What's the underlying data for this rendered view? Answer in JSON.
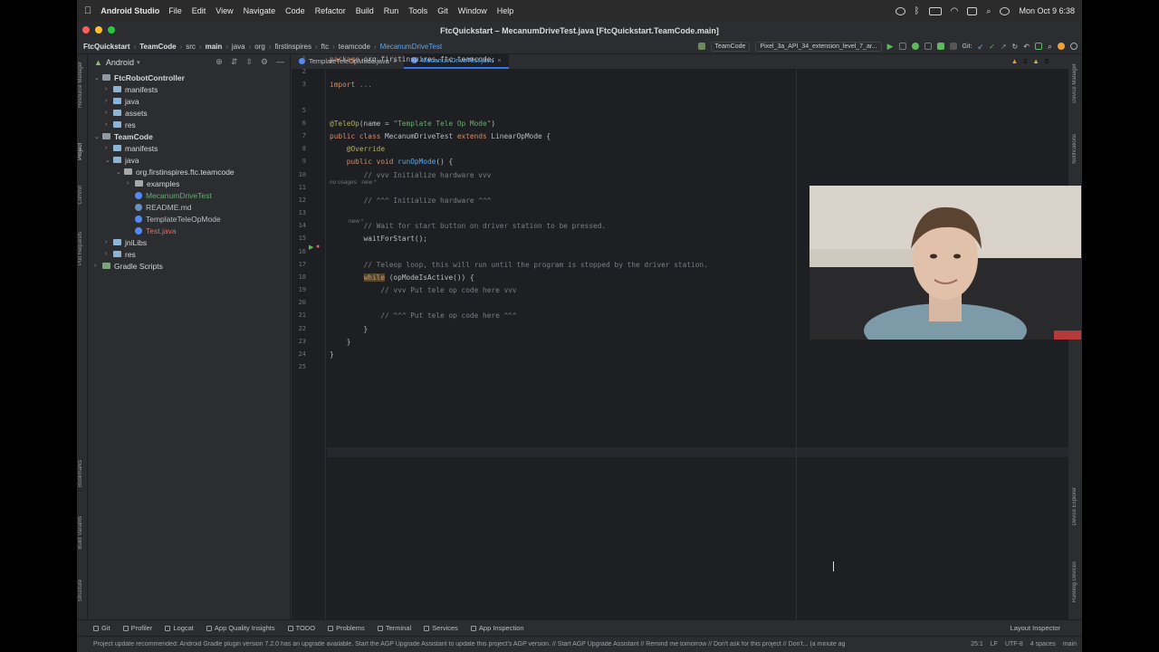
{
  "menubar": {
    "app_name": "Android Studio",
    "menus": [
      "File",
      "Edit",
      "View",
      "Navigate",
      "Code",
      "Refactor",
      "Build",
      "Run",
      "Tools",
      "Git",
      "Window",
      "Help"
    ],
    "clock": "Mon Oct 9  6:38"
  },
  "window": {
    "title": "FtcQuickstart – MecanumDriveTest.java [FtcQuickstart.TeamCode.main]"
  },
  "breadcrumbs": [
    "FtcQuickstart",
    "TeamCode",
    "src",
    "main",
    "java",
    "org",
    "firstinspires",
    "ftc",
    "teamcode",
    "MecanumDriveTest"
  ],
  "toolbar": {
    "run_config": "TeamCode",
    "device": "Pixel_3a_API_34_extension_level_7_ar...",
    "git_label": "Git:"
  },
  "project_panel": {
    "view_mode": "Android",
    "tree": [
      {
        "label": "FtcRobotController",
        "level": 0,
        "type": "module",
        "expanded": true,
        "bold": true
      },
      {
        "label": "manifests",
        "level": 1,
        "type": "folder",
        "expanded": false
      },
      {
        "label": "java",
        "level": 1,
        "type": "folder",
        "expanded": false
      },
      {
        "label": "assets",
        "level": 1,
        "type": "folder",
        "expanded": false
      },
      {
        "label": "res",
        "level": 1,
        "type": "folder",
        "expanded": false
      },
      {
        "label": "TeamCode",
        "level": 0,
        "type": "module",
        "expanded": true,
        "bold": true
      },
      {
        "label": "manifests",
        "level": 1,
        "type": "folder",
        "expanded": false
      },
      {
        "label": "java",
        "level": 1,
        "type": "folder",
        "expanded": true
      },
      {
        "label": "org.firstinspires.ftc.teamcode",
        "level": 2,
        "type": "package",
        "expanded": true
      },
      {
        "label": "examples",
        "level": 3,
        "type": "package",
        "expanded": false
      },
      {
        "label": "MecanumDriveTest",
        "level": 3,
        "type": "file",
        "color": "#6aab73",
        "selected": true
      },
      {
        "label": "README.md",
        "level": 3,
        "type": "file",
        "color": "#bcbec4"
      },
      {
        "label": "TemplateTeleOpMode",
        "level": 3,
        "type": "file",
        "color": "#bcbec4"
      },
      {
        "label": "Test.java",
        "level": 3,
        "type": "file",
        "color": "#e06c60"
      },
      {
        "label": "jniLibs",
        "level": 1,
        "type": "folder",
        "expanded": false
      },
      {
        "label": "res",
        "level": 1,
        "type": "folder",
        "expanded": false
      },
      {
        "label": "Gradle Scripts",
        "level": 0,
        "type": "gradle",
        "expanded": false
      }
    ]
  },
  "left_strip_labels": [
    "Resource Manager",
    "Project",
    "Commit",
    "Pull Requests",
    "Bookmarks",
    "Build Variants",
    "Structure"
  ],
  "right_strip_labels": [
    "Device Manager",
    "Notifications",
    "Device Explorer",
    "Running Devices"
  ],
  "editor": {
    "tabs": [
      {
        "label": "TemplateTeleOpMode.java",
        "active": false
      },
      {
        "label": "MecanumDriveTest.java",
        "active": true
      }
    ],
    "inspections": {
      "warnings": "2",
      "weak_warnings": "5"
    },
    "usage_hint": "no usages   new *",
    "new_hint": "new *",
    "lines": [
      {
        "n": "1",
        "segs": [
          [
            "kw",
            "package "
          ],
          [
            "",
            "org.firstinspires.ftc.teamcode;"
          ]
        ]
      },
      {
        "n": "2",
        "segs": []
      },
      {
        "n": "3",
        "segs": [
          [
            "kw",
            "import "
          ],
          [
            "cm",
            "..."
          ]
        ]
      },
      {
        "n": "5",
        "segs": []
      },
      {
        "n": "6",
        "segs": [
          [
            "ann",
            "@TeleOp"
          ],
          [
            "",
            "(name = "
          ],
          [
            "str",
            "\"Template Tele Op Mode\""
          ],
          [
            "",
            ")"
          ]
        ]
      },
      {
        "n": "7",
        "segs": [
          [
            "kw",
            "public class "
          ],
          [
            "",
            "MecanumDriveTest "
          ],
          [
            "kw",
            "extends "
          ],
          [
            "",
            "LinearOpMode {"
          ]
        ]
      },
      {
        "n": "8",
        "segs": [
          [
            "",
            "    "
          ],
          [
            "ann",
            "@Override"
          ]
        ]
      },
      {
        "n": "9",
        "segs": [
          [
            "",
            "    "
          ],
          [
            "kw",
            "public void "
          ],
          [
            "fn",
            "runOpMode"
          ],
          [
            "",
            "() {"
          ]
        ]
      },
      {
        "n": "10",
        "segs": [
          [
            "",
            "        "
          ],
          [
            "cm",
            "// vvv Initialize hardware vvv"
          ]
        ]
      },
      {
        "n": "11",
        "segs": []
      },
      {
        "n": "12",
        "segs": [
          [
            "",
            "        "
          ],
          [
            "cm",
            "// ^^^ Initialize hardware ^^^"
          ]
        ]
      },
      {
        "n": "13",
        "segs": []
      },
      {
        "n": "14",
        "segs": [
          [
            "",
            "        "
          ],
          [
            "cm",
            "// Wait for start button on driver station to be pressed."
          ]
        ]
      },
      {
        "n": "15",
        "segs": [
          [
            "",
            "        waitForStart();"
          ]
        ]
      },
      {
        "n": "16",
        "segs": []
      },
      {
        "n": "17",
        "segs": [
          [
            "",
            "        "
          ],
          [
            "cm",
            "// Teleop loop, this will run until the program is stopped by the driver station."
          ]
        ]
      },
      {
        "n": "18",
        "segs": [
          [
            "",
            "        "
          ],
          [
            "kwhl",
            "while"
          ],
          [
            "",
            " (opModeIsActive()) {"
          ]
        ]
      },
      {
        "n": "19",
        "segs": [
          [
            "",
            "            "
          ],
          [
            "cm",
            "// vvv Put tele op code here vvv"
          ]
        ]
      },
      {
        "n": "20",
        "segs": []
      },
      {
        "n": "21",
        "segs": [
          [
            "",
            "            "
          ],
          [
            "cm",
            "// ^^^ Put tele op code here ^^^"
          ]
        ]
      },
      {
        "n": "22",
        "segs": [
          [
            "",
            "        }"
          ]
        ]
      },
      {
        "n": "23",
        "segs": [
          [
            "",
            "    }"
          ]
        ]
      },
      {
        "n": "24",
        "segs": [
          [
            "",
            "}"
          ]
        ]
      },
      {
        "n": "25",
        "segs": []
      }
    ]
  },
  "bottom_tools": [
    "Git",
    "Profiler",
    "Logcat",
    "App Quality Insights",
    "TODO",
    "Problems",
    "Terminal",
    "Services",
    "App Inspection"
  ],
  "layout_inspector": "Layout Inspector",
  "status": {
    "message": "Project update recommended: Android Gradle plugin version 7.2.0 has an upgrade available.  Start the AGP Upgrade Assistant to update this project's AGP version. // Start AGP Upgrade Assistant // Remind me tomorrow // Don't ask for this project // Don't... (a minute ag",
    "position": "25:1",
    "line_sep": "LF",
    "encoding": "UTF-8",
    "indent": "4 spaces",
    "branch": "main"
  },
  "colors": {
    "accent": "#3574f0",
    "editor_bg": "#1e1f22",
    "panel_bg": "#2b2d30"
  }
}
